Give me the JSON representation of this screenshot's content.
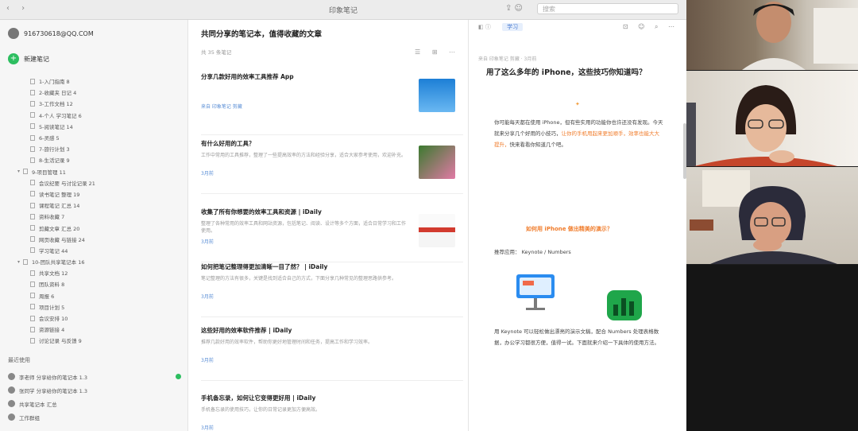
{
  "window": {
    "title": "印象笔记",
    "search_placeholder": "搜索"
  },
  "sidebar": {
    "account": "916730618@QQ.COM",
    "new_label": "新建笔记",
    "tree": [
      {
        "label": "1-入门指南 8",
        "level": 1
      },
      {
        "label": "2-收藏夹 日记 4",
        "level": 1
      },
      {
        "label": "3-工作文档 12",
        "level": 1
      },
      {
        "label": "4-个人 学习笔记 6",
        "level": 1
      },
      {
        "label": "5-阅读笔记 14",
        "level": 1
      },
      {
        "label": "6-灵感 5",
        "level": 1
      },
      {
        "label": "7-旅行计划 3",
        "level": 1
      },
      {
        "label": "8-生活记录 9",
        "level": 1
      },
      {
        "label": "9-项目管理 11",
        "level": 0
      },
      {
        "label": "会议纪要 与讨论记录 21",
        "level": 1
      },
      {
        "label": "读书笔记 整理 19",
        "level": 1
      },
      {
        "label": "课程笔记 汇总 14",
        "level": 1
      },
      {
        "label": "资料收藏 7",
        "level": 1
      },
      {
        "label": "剪藏文章 汇总 20",
        "level": 1
      },
      {
        "label": "网页收藏 与链接 24",
        "level": 1
      },
      {
        "label": "学习笔记 44",
        "level": 1
      },
      {
        "label": "10-团队共享笔记本 16",
        "level": 0
      },
      {
        "label": "共享文档 12",
        "level": 1
      },
      {
        "label": "团队资料 8",
        "level": 1
      },
      {
        "label": "周报 6",
        "level": 1
      },
      {
        "label": "项目计划 5",
        "level": 1
      },
      {
        "label": "会议安排 10",
        "level": 1
      },
      {
        "label": "资源链接 4",
        "level": 1
      },
      {
        "label": "讨论记录 与反馈 9",
        "level": 1
      }
    ],
    "recent_head": "最近使用",
    "recent": [
      {
        "label": "李老师 分享给你的笔记本 1.3"
      },
      {
        "label": "张同学 分享给你的笔记本 1.3"
      },
      {
        "label": "共享笔记本 汇总"
      },
      {
        "label": "工作群组"
      }
    ]
  },
  "notelist": {
    "title": "共同分享的笔记本，值得收藏的文章",
    "count": "共 35 条笔记",
    "notes": [
      {
        "title": "分享几款好用的效率工具推荐 App",
        "snippet": "",
        "meta": "来自 印象笔记 剪藏"
      },
      {
        "title": "有什么好用的工具？",
        "snippet": "工作中常用的工具推荐，整理了一些提高效率的方法和经验分享，适合大家参考使用，欢迎补充。",
        "meta": "3月前"
      },
      {
        "title": "收集了所有你想要的效率工具和资源 | iDaily",
        "snippet": "整理了各种常用的效率工具和网站资源，包括笔记、阅读、设计等多个方面，适合日常学习和工作使用。",
        "meta": "3月前"
      },
      {
        "title": "如何把笔记整理得更加清晰一目了然？ | iDaily",
        "snippet": "笔记整理的方法有很多，关键是找到适合自己的方式，下面分享几种常见的整理思路供参考。",
        "meta": "3月前"
      },
      {
        "title": "这些好用的效率软件推荐 | iDaily",
        "snippet": "推荐几款好用的效率软件，帮助你更好地管理时间和任务，提高工作和学习效率。",
        "meta": "3月前"
      },
      {
        "title": "手机备忘录，如何让它变得更好用 | iDaily",
        "snippet": "手机备忘录的使用技巧，让你的日常记录更加方便高效。",
        "meta": "3月前"
      }
    ]
  },
  "editor": {
    "notebook": "学习",
    "meta": "来自 印象笔记 剪藏 · 3月前",
    "title": "用了这么多年的 iPhone，这些技巧你知道吗？",
    "para1": "你可能每天都在使用 iPhone，但有些实用的功能你也许还没有发现。今天就来分享几个好用的小技巧，",
    "para1_hl": "让你的手机用起来更加顺手，效率也能大大提升，",
    "para1_end": "快来看看你知道几个吧。",
    "link": "如何用 iPhone 做出精美的演示？",
    "from": "推荐应用： Keynote / Numbers",
    "para2": "用 Keynote 可以轻松做出漂亮的演示文稿，配合 Numbers 处理表格数据，办公学习都很方便，值得一试。下面就来介绍一下具体的使用方法。"
  }
}
